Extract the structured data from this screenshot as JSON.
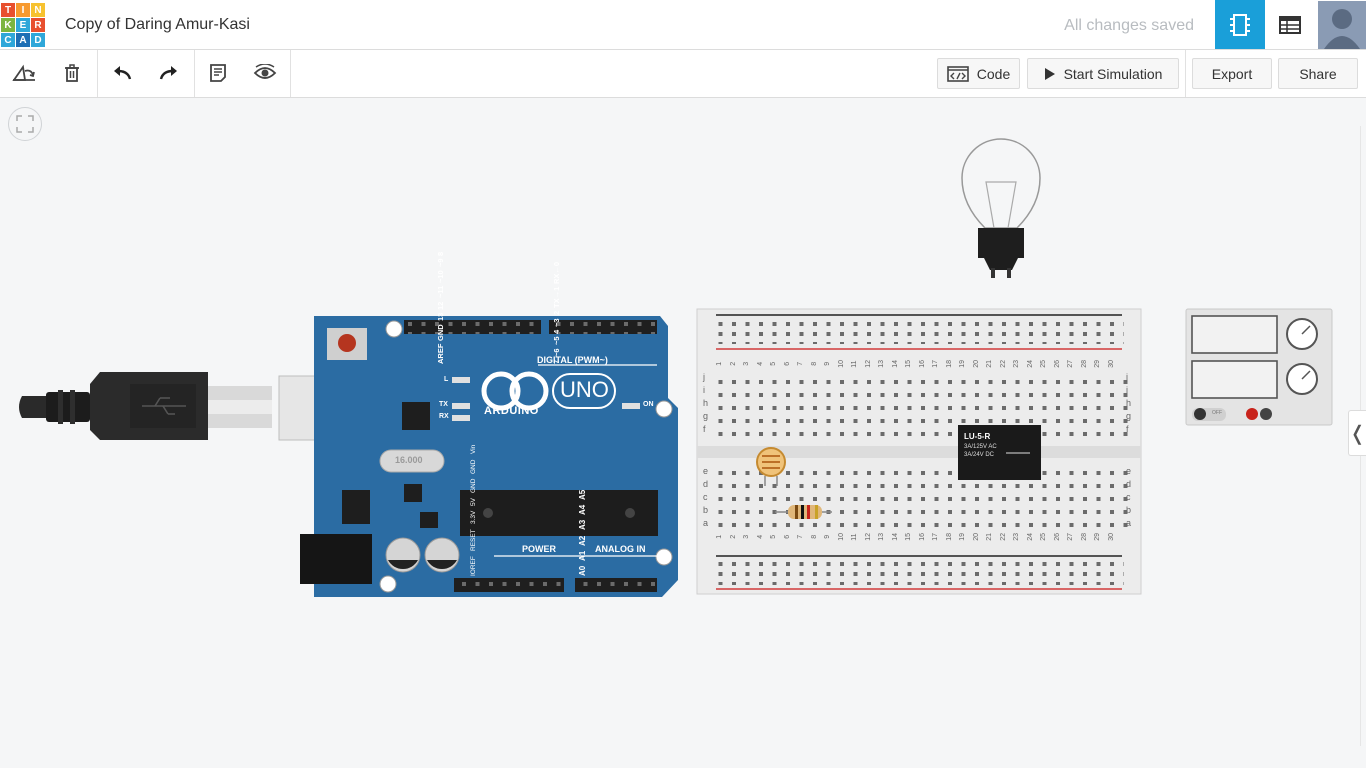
{
  "logo": {
    "letters": [
      "T",
      "I",
      "N",
      "K",
      "E",
      "R",
      "C",
      "A",
      "D"
    ]
  },
  "header": {
    "title": "Copy of Daring Amur-Kasi",
    "save_status": "All changes saved"
  },
  "toolbar": {
    "code_label": "Code",
    "simulate_label": "Start Simulation",
    "export_label": "Export",
    "share_label": "Share"
  },
  "arduino": {
    "brand": "ARDUINO",
    "model": "UNO",
    "digital_label": "DIGITAL (PWM~)",
    "power_label": "POWER",
    "analog_label": "ANALOG IN",
    "on_label": "ON",
    "led_l": "L",
    "led_tx": "TX",
    "led_rx": "RX",
    "top_pins": [
      "AREF",
      "GND",
      "13",
      "12",
      "~11",
      "~10",
      "~9",
      "8"
    ],
    "top_pins2": [
      "7",
      "~6",
      "~5",
      "4",
      "~3",
      "2",
      "TX→1",
      "RX←0"
    ],
    "power_pins": [
      "IOREF",
      "RESET",
      "3.3V",
      "5V",
      "GND",
      "GND",
      "Vin"
    ],
    "analog_pins": [
      "A0",
      "A1",
      "A2",
      "A3",
      "A4",
      "A5"
    ],
    "crystal": "16.000"
  },
  "breadboard": {
    "row_letters_top": [
      "j",
      "i",
      "h",
      "g",
      "f"
    ],
    "row_letters_bottom": [
      "e",
      "d",
      "c",
      "b",
      "a"
    ],
    "columns": 30
  },
  "relay": {
    "model": "LU-5-R",
    "rating1": "3A/125V AC",
    "rating2": "3A/24V DC"
  },
  "power_supply": {
    "off_label": "OFF"
  },
  "colors": {
    "accent": "#1a9fd9",
    "arduino": "#2b6ca3",
    "canvas": "#f5f6f7"
  }
}
